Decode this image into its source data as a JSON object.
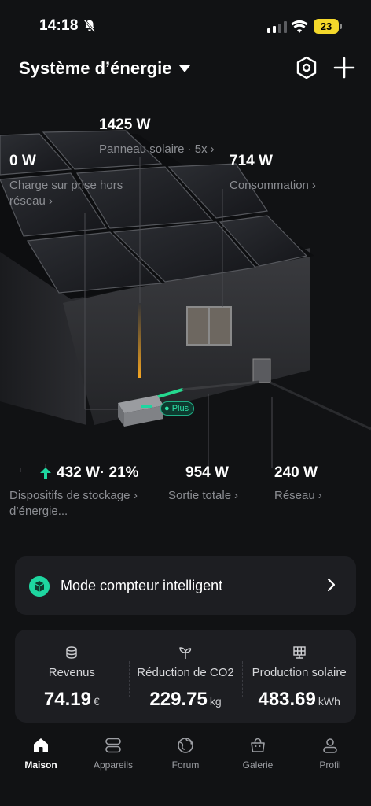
{
  "status_bar": {
    "time": "14:18",
    "battery": "23"
  },
  "header": {
    "title": "Système d’énergie"
  },
  "scene": {
    "solar": {
      "value": "1425 W",
      "label": "Panneau solaire · 5x"
    },
    "offgrid": {
      "value": "0 W",
      "label": "Charge sur prise hors réseau"
    },
    "consumption": {
      "value": "714 W",
      "label": "Consommation"
    },
    "storage": {
      "value": "432 W· 21%",
      "label": "Dispositifs de stockage d’énergie..."
    },
    "output": {
      "value": "954 W",
      "label": "Sortie totale"
    },
    "grid": {
      "value": "240 W",
      "label": "Réseau"
    },
    "badge": "Plus"
  },
  "smart_meter": {
    "label": "Mode compteur intelligent"
  },
  "stats": [
    {
      "label": "Revenus",
      "value": "74.19",
      "unit": "€"
    },
    {
      "label": "Réduction de CO2",
      "value": "229.75",
      "unit": "kg"
    },
    {
      "label": "Production solaire",
      "value": "483.69",
      "unit": "kWh"
    }
  ],
  "tabs": [
    {
      "label": "Maison",
      "icon": "home-icon",
      "active": true
    },
    {
      "label": "Appareils",
      "icon": "devices-icon"
    },
    {
      "label": "Forum",
      "icon": "globe-icon"
    },
    {
      "label": "Galerie",
      "icon": "bag-icon"
    },
    {
      "label": "Profil",
      "icon": "profile-icon"
    }
  ],
  "colors": {
    "accent": "#1ed6a0",
    "background": "#111214",
    "card": "#1d1e22",
    "battery": "#f4d82b",
    "solar_flow": "#f5a623"
  }
}
